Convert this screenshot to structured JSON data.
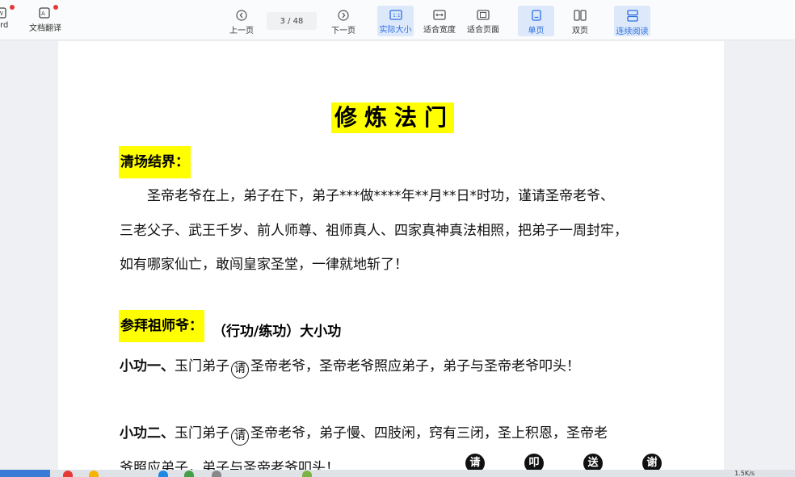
{
  "toolbar": {
    "left": [
      {
        "label": "ord",
        "icon": "word-icon"
      },
      {
        "label": "文档翻译",
        "icon": "translate-icon"
      }
    ],
    "prev_label": "上一页",
    "next_label": "下一页",
    "page_current": "3",
    "page_total": "/ 48",
    "view": {
      "actual_size": "实际大小",
      "fit_width": "适合宽度",
      "fit_page": "适合页面",
      "single_page": "单页",
      "double_page": "双页",
      "continuous": "连续阅读"
    },
    "active_color": "#2c6fe0"
  },
  "document": {
    "title": "修炼法门",
    "section1_heading": "清场结界：",
    "section1_lines": [
      "　　圣帝老爷在上，弟子在下，弟子***做****年**月**日*时功，谨请圣帝老爷、",
      "三老父子、武王千岁、前人师尊、祖师真人、四家真神真法相照，把弟子一周封牢，",
      "如有哪家仙亡，敢闯皇家圣堂，一律就地斩了！"
    ],
    "section2_heading_hl": "参拜祖师爷：",
    "section2_heading_rest": "（行功/练功）大小功",
    "small1_label": "小功一、",
    "small1_pre": "玉门弟子",
    "small1_circle": "请",
    "small1_post": "圣帝老爷，圣帝老爷照应弟子，弟子与圣帝老爷叩头！",
    "small2_label": "小功二、",
    "small2_pre": "玉门弟子",
    "small2_circle": "请",
    "small2_post": "圣帝老爷，弟子慢、四肢闲，窍有三闭，圣上积恩，圣帝老",
    "small2_line2": "爷照应弟子，弟子与圣帝老爷叩头！",
    "seals": [
      "请",
      "叩",
      "送",
      "谢"
    ],
    "highlight_color": "#ffff00"
  },
  "taskbar": {
    "net_speed": "1.5K/s"
  }
}
